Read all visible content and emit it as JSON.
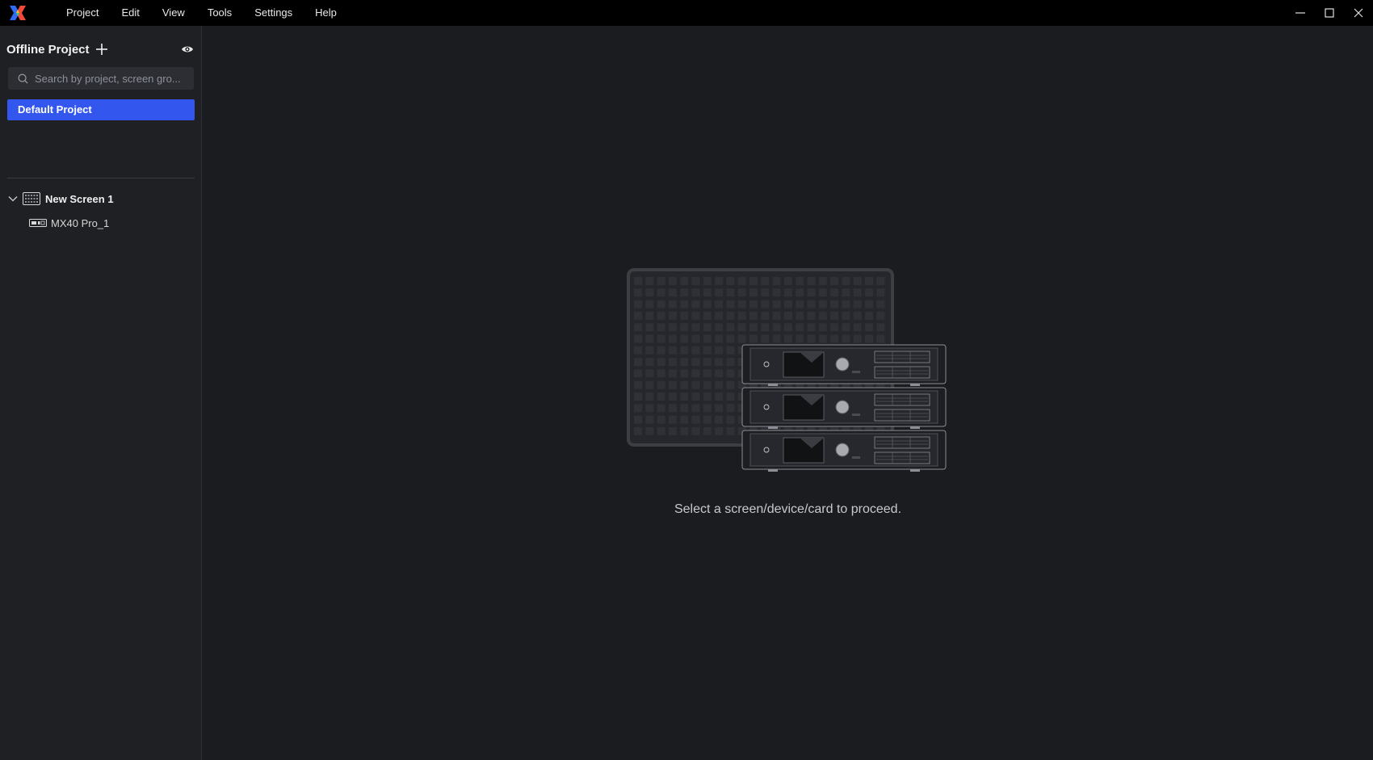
{
  "menu": {
    "items": [
      "Project",
      "Edit",
      "View",
      "Tools",
      "Settings",
      "Help"
    ]
  },
  "window_controls": [
    "minimize-icon",
    "maximize-icon",
    "close-icon"
  ],
  "sidebar": {
    "title": "Offline Project",
    "add_icon": "plus-icon",
    "visibility_icon": "eye-icon",
    "search": {
      "placeholder": "Search by project, screen gro...",
      "icon": "search-icon"
    },
    "projects": [
      {
        "label": "Default Project",
        "selected": true
      }
    ],
    "tree": {
      "screen": {
        "label": "New Screen 1",
        "expanded": true,
        "icon": "led-screen-icon"
      },
      "devices": [
        {
          "label": "MX40 Pro_1",
          "icon": "controller-device-icon"
        }
      ]
    }
  },
  "main": {
    "empty_message": "Select a screen/device/card to proceed."
  },
  "colors": {
    "titlebar": "#000000",
    "background": "#1b1c20",
    "sidebar": "#1f2024",
    "accent": "#3357ee"
  }
}
